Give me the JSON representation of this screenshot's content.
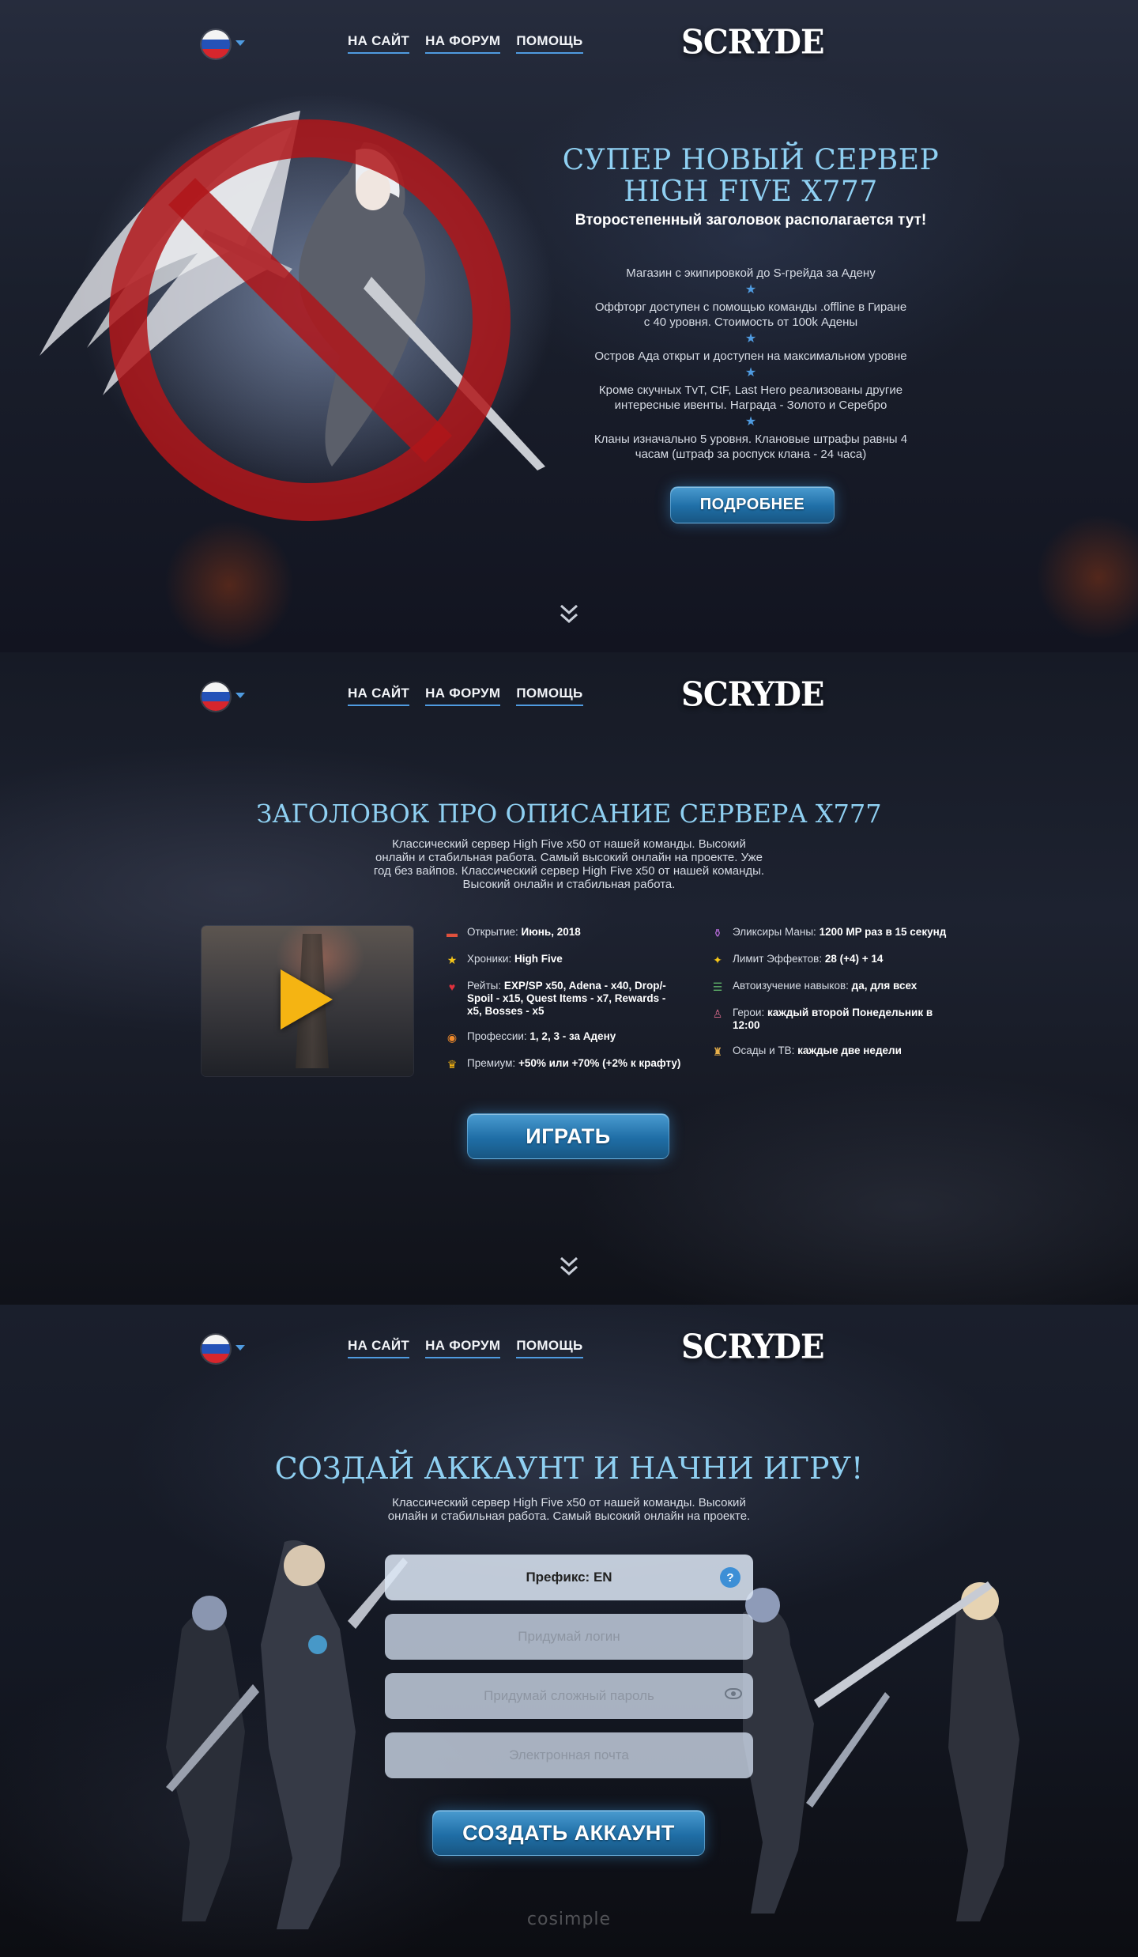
{
  "header": {
    "language": "RU",
    "nav": [
      "НА САЙТ",
      "НА ФОРУМ",
      "ПОМОЩЬ"
    ],
    "logo": "SCRYDE"
  },
  "hero": {
    "title_line1": "СУПЕР НОВЫЙ СЕРВЕР",
    "title_line2": "HIGH FIVE X777",
    "subtitle": "Второстепенный заголовок располагается тут!",
    "features": [
      "Магазин с экипировкой до S-грейда за Адену",
      "Оффторг доступен с помощью команды .offline в Гиране с 40 уровня. Стоимость от 100k Адены",
      "Остров Ада открыт и доступен на максимальном уровне",
      "Кроме скучных TvT, CtF, Last Hero реализованы другие интересные ивенты. Награда - Золото и Серебро",
      "Кланы изначально 5 уровня. Клановые штрафы равны 4 часам (штраф за роспуск клана - 24 часа)"
    ],
    "button": "ПОДРОБНЕЕ"
  },
  "about": {
    "title": "ЗАГОЛОВОК ПРО ОПИСАНИЕ СЕРВЕРА X777",
    "description": "Классический сервер High Five x50 от нашей команды. Высокий онлайн и стабильная работа. Самый высокий онлайн на проекте. Уже год без вайпов. Классический сервер High Five x50 от нашей команды. Высокий онлайн и стабильная работа.",
    "info_left": [
      {
        "icon": "calendar-icon",
        "label": "Открытие: ",
        "value": "Июнь, 2018"
      },
      {
        "icon": "star-icon",
        "label": "Хроники: ",
        "value": "High Five"
      },
      {
        "icon": "heart-icon",
        "label": "Рейты: ",
        "value": "EXP/SP x50, Adena - x40, Drop/-Spoil - x15, Quest Items - x7, Rewards - x5, Bosses - x5"
      },
      {
        "icon": "donut-icon",
        "label": "Профессии: ",
        "value": "1, 2, 3 - за Адену"
      },
      {
        "icon": "crown-icon",
        "label": "Премиум: ",
        "value": "+50% или +70% (+2% к крафту)"
      }
    ],
    "info_right": [
      {
        "icon": "potion-icon",
        "label": "Эликсиры Маны: ",
        "value": "1200 MP раз в 15 секунд"
      },
      {
        "icon": "wand-icon",
        "label": "Лимит Эффектов: ",
        "value": "28 (+4) + 14"
      },
      {
        "icon": "books-icon",
        "label": "Автоизучение навыков: ",
        "value": "да, для всех"
      },
      {
        "icon": "hero-icon",
        "label": "Герои: ",
        "value": "каждый второй Понедельник в 12:00"
      },
      {
        "icon": "siege-icon",
        "label": "Осады и ТВ: ",
        "value": "каждые две недели"
      }
    ],
    "button": "ИГРАТЬ"
  },
  "register": {
    "title": "СОЗДАЙ АККАУНТ И НАЧНИ ИГРУ!",
    "description": "Классический сервер High Five x50 от нашей команды. Высокий онлайн и стабильная работа. Самый высокий онлайн на проекте.",
    "prefix": "Префикс: EN",
    "login_placeholder": "Придумай логин",
    "password_placeholder": "Придумай сложный пароль",
    "email_placeholder": "Электронная почта",
    "button": "СОЗДАТЬ АККАУНТ"
  },
  "footer": {
    "credit": "cosimple"
  },
  "colors": {
    "accent": "#8fd0f2",
    "button": "#1f6ea6",
    "link_underline": "#4f9be0",
    "ban_sign": "#b0161a",
    "play": "#f5b412"
  }
}
